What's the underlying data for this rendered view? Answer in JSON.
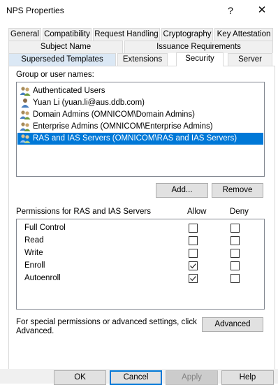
{
  "window": {
    "title": "NPS Properties",
    "help_glyph": "?",
    "close_glyph": "✕"
  },
  "tabs_row1": [
    {
      "label": "General"
    },
    {
      "label": "Compatibility"
    },
    {
      "label": "Request Handling"
    },
    {
      "label": "Cryptography"
    },
    {
      "label": "Key Attestation"
    }
  ],
  "tabs_row2": [
    {
      "label": "Subject Name"
    },
    {
      "label": "Issuance Requirements"
    }
  ],
  "tabs_row3": [
    {
      "label": "Superseded Templates"
    },
    {
      "label": "Extensions"
    },
    {
      "label": "Security"
    },
    {
      "label": "Server"
    }
  ],
  "active_tab": "Security",
  "security": {
    "group_label": "Group or user names:",
    "users": [
      {
        "name": "Authenticated Users",
        "icon": "users-group-icon"
      },
      {
        "name": "Yuan Li (yuan.li@aus.ddb.com)",
        "icon": "user-icon"
      },
      {
        "name": "Domain Admins (OMNICOM\\Domain Admins)",
        "icon": "users-group-icon"
      },
      {
        "name": "Enterprise Admins (OMNICOM\\Enterprise Admins)",
        "icon": "users-group-icon"
      },
      {
        "name": "RAS and IAS Servers (OMNICOM\\RAS and IAS Servers)",
        "icon": "users-group-icon",
        "selected": true
      }
    ],
    "add_label": "Add...",
    "remove_label": "Remove",
    "perm_header": "Permissions for RAS and IAS Servers",
    "allow_label": "Allow",
    "deny_label": "Deny",
    "permissions": [
      {
        "name": "Full Control",
        "allow": false,
        "deny": false
      },
      {
        "name": "Read",
        "allow": false,
        "deny": false
      },
      {
        "name": "Write",
        "allow": false,
        "deny": false
      },
      {
        "name": "Enroll",
        "allow": true,
        "deny": false
      },
      {
        "name": "Autoenroll",
        "allow": true,
        "deny": false
      }
    ],
    "special_text_line1": "For special permissions or advanced settings, click",
    "special_text_line2": "Advanced.",
    "advanced_label": "Advanced"
  },
  "buttons": {
    "ok": "OK",
    "cancel": "Cancel",
    "apply": "Apply",
    "help": "Help"
  },
  "colors": {
    "selection": "#0078d7",
    "tab_highlight": "#dbe8f5",
    "border": "#d9d9d9"
  }
}
